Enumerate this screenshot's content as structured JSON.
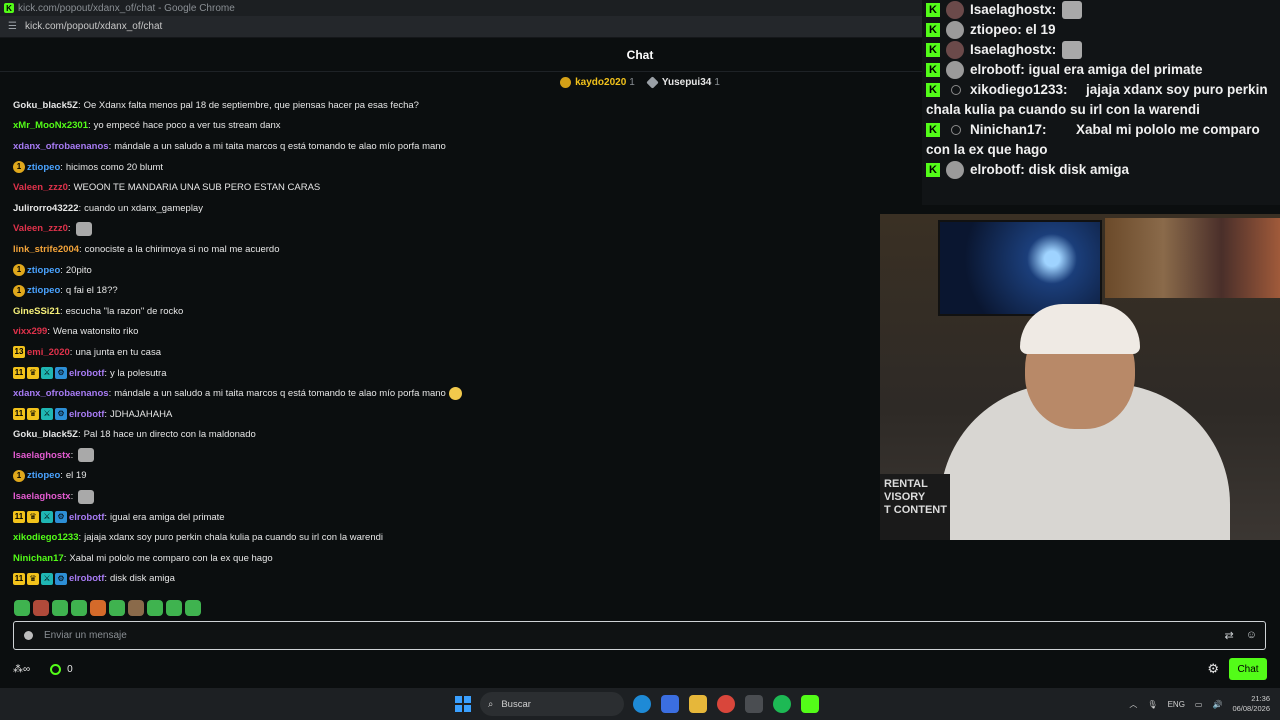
{
  "window": {
    "title": "kick.com/popout/xdanx_of/chat - Google Chrome",
    "url": "kick.com/popout/xdanx_of/chat"
  },
  "header": {
    "title": "Chat"
  },
  "pinned_gifters": [
    {
      "name": "kaydo2020",
      "count": "1",
      "color": "#f2c21b"
    },
    {
      "name": "Yusepui34",
      "count": "1",
      "color": "#f2c21b"
    }
  ],
  "messages": [
    {
      "badges": [],
      "user": "Goku_black5Z",
      "color": "#e6e6e6",
      "text": "Oe Xdanx falta menos pal 18 de septiembre, que piensas hacer pa esas fecha?"
    },
    {
      "badges": [],
      "user": "xMr_MooNx2301",
      "color": "#53fc18",
      "text": "yo empecé hace poco a ver tus stream danx"
    },
    {
      "badges": [],
      "user": "xdanx_ofrobaenanos",
      "color": "#a77bf3",
      "text": "mándale a un saludo a mi taita marcos q está tomando te alao mío porfa mano"
    },
    {
      "badges": [
        "coin"
      ],
      "user": "ztiopeo",
      "color": "#4aa3ff",
      "text": "hicimos como 20 blumt"
    },
    {
      "badges": [],
      "user": "Valeen_zzz0",
      "color": "#e0324b",
      "text": "WEOON TE MANDARIA UNA SUB PERO ESTAN CARAS"
    },
    {
      "badges": [],
      "user": "Julirorro43222",
      "color": "#e6e6e6",
      "text": "cuando un xdanx_gameplay"
    },
    {
      "badges": [],
      "user": "Valeen_zzz0",
      "color": "#e0324b",
      "text": "",
      "emote": true
    },
    {
      "badges": [],
      "user": "link_strife2004",
      "color": "#f2a33a",
      "text": "conociste a la chirimoya si no mal me acuerdo"
    },
    {
      "badges": [
        "coin"
      ],
      "user": "ztiopeo",
      "color": "#4aa3ff",
      "text": "20pito"
    },
    {
      "badges": [
        "coin"
      ],
      "user": "ztiopeo",
      "color": "#4aa3ff",
      "text": "q fai el 18??"
    },
    {
      "badges": [],
      "user": "GineSSi21",
      "color": "#f6f07a",
      "text": "escucha \"la razon\" de rocko"
    },
    {
      "badges": [],
      "user": "vixx299",
      "color": "#e0324b",
      "text": "Wena watonsito riko"
    },
    {
      "badges": [
        "sub13"
      ],
      "user": "emi_2020",
      "color": "#e0324b",
      "text": "una junta en tu casa"
    },
    {
      "badges": [
        "sub",
        "crown",
        "mod",
        "bot"
      ],
      "user": "elrobotf",
      "color": "#a77bf3",
      "text": "y la polesutra"
    },
    {
      "badges": [],
      "user": "xdanx_ofrobaenanos",
      "color": "#a77bf3",
      "text": "mándale a un saludo a mi taita marcos q está tomando te alao mío porfa mano",
      "emoji": true
    },
    {
      "badges": [
        "sub",
        "crown",
        "mod",
        "bot"
      ],
      "user": "elrobotf",
      "color": "#a77bf3",
      "text": "JDHAJAHAHA"
    },
    {
      "badges": [],
      "user": "Goku_black5Z",
      "color": "#e6e6e6",
      "text": "Pal 18 hace un directo con la maldonado"
    },
    {
      "badges": [],
      "user": "Isaelaghostx",
      "color": "#e35bd0",
      "text": "",
      "emote": true
    },
    {
      "badges": [
        "coin"
      ],
      "user": "ztiopeo",
      "color": "#4aa3ff",
      "text": "el 19"
    },
    {
      "badges": [],
      "user": "Isaelaghostx",
      "color": "#e35bd0",
      "text": "",
      "emote": true
    },
    {
      "badges": [
        "sub",
        "crown",
        "mod",
        "bot"
      ],
      "user": "elrobotf",
      "color": "#a77bf3",
      "text": "igual era amiga del primate"
    },
    {
      "badges": [],
      "user": "xikodiego1233",
      "color": "#53fc18",
      "text": "jajaja xdanx soy puro perkin chala kulia pa cuando su irl con la warendi"
    },
    {
      "badges": [],
      "user": "Ninichan17",
      "color": "#53fc18",
      "text": "Xabal mi pololo me comparo con la ex que hago"
    },
    {
      "badges": [
        "sub",
        "crown",
        "mod",
        "bot"
      ],
      "user": "elrobotf",
      "color": "#a77bf3",
      "text": "disk disk amiga"
    }
  ],
  "input": {
    "placeholder": "Enviar un mensaje"
  },
  "bottom": {
    "points": "0",
    "chat_button": "Chat"
  },
  "overlay": [
    {
      "avatar": "dark",
      "user": "Isaelaghostx",
      "text": "",
      "emote": true
    },
    {
      "avatar": "grey",
      "user": "ztiopeo",
      "text": "el 19"
    },
    {
      "avatar": "dark",
      "user": "Isaelaghostx",
      "text": "",
      "emote": true
    },
    {
      "avatar": "grey",
      "user": "elrobotf",
      "text": "igual era amiga del primate"
    },
    {
      "avatar": "person",
      "user": "xikodiego1233",
      "text": "jajaja xdanx soy puro perkin chala kulia pa cuando su irl con la warendi"
    },
    {
      "avatar": "person",
      "user": "Ninichan17",
      "text": "Xabal mi pololo me comparo con la ex que hago"
    },
    {
      "avatar": "grey",
      "user": "elrobotf",
      "text": "disk disk amiga"
    }
  ],
  "webcam": {
    "sign_text": "RENTAL\nVISORY\nT CONTENT"
  },
  "taskbar": {
    "search": "Buscar",
    "lang": "ENG",
    "time": "21:36",
    "date": "06/08/2026"
  },
  "colors": {
    "kick_green": "#53fc18",
    "background": "#0b0e0f"
  }
}
